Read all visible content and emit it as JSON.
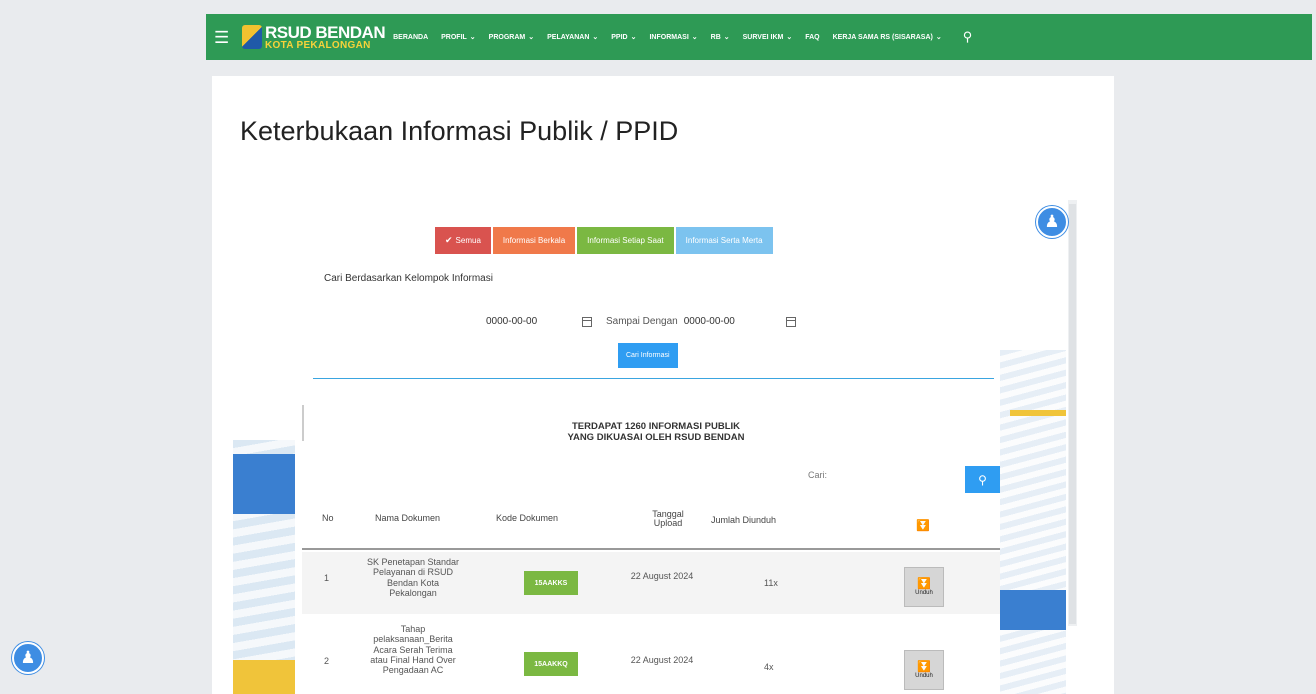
{
  "nav": {
    "logo_title": "RSUD BENDAN",
    "logo_sub": "KOTA PEKALONGAN",
    "items": [
      {
        "label": "BERANDA",
        "dropdown": false
      },
      {
        "label": "PROFIL",
        "dropdown": true
      },
      {
        "label": "PROGRAM",
        "dropdown": true
      },
      {
        "label": "PELAYANAN",
        "dropdown": true
      },
      {
        "label": "PPID",
        "dropdown": true
      },
      {
        "label": "INFORMASI",
        "dropdown": true
      },
      {
        "label": "RB",
        "dropdown": true
      },
      {
        "label": "SURVEI IKM",
        "dropdown": true
      },
      {
        "label": "FAQ",
        "dropdown": false
      },
      {
        "label": "KERJA SAMA RS (SISARASA)",
        "dropdown": true
      }
    ],
    "accent_color": "#2e9a55"
  },
  "page": {
    "title": "Keterbukaan Informasi Publik / PPID"
  },
  "filters": {
    "semua": "Semua",
    "berkala": "Informasi Berkala",
    "setiap_saat": "Informasi Setiap Saat",
    "serta_merta": "Informasi Serta Merta"
  },
  "search_form": {
    "group_label": "Cari Berdasarkan Kelompok Informasi",
    "date_from": "0000-00-00",
    "sampai_label": "Sampai Dengan",
    "date_to": "0000-00-00",
    "submit_label": "Cari Informasi"
  },
  "summary": {
    "line1": "TERDAPAT 1260 INFORMASI PUBLIK",
    "line2": "YANG DIKUASAI OLEH RSUD BENDAN"
  },
  "table": {
    "search_placeholder": "Cari:",
    "headers": {
      "no": "No",
      "nama": "Nama Dokumen",
      "kode": "Kode Dokumen",
      "tanggal": "Tanggal Upload",
      "jumlah": "Jumlah Diunduh"
    },
    "rows": [
      {
        "no": "1",
        "nama": "SK Penetapan Standar Pelayanan di RSUD Bendan Kota Pekalongan",
        "kode": "15AAKKS",
        "tanggal": "22 August 2024",
        "jumlah": "11x",
        "unduh": "Unduh"
      },
      {
        "no": "2",
        "nama": "Tahap pelaksanaan_Berita Acara Serah Terima atau Final Hand Over Pengadaan AC",
        "kode": "15AAKKQ",
        "tanggal": "22 August 2024",
        "jumlah": "4x",
        "unduh": "Unduh"
      }
    ]
  }
}
